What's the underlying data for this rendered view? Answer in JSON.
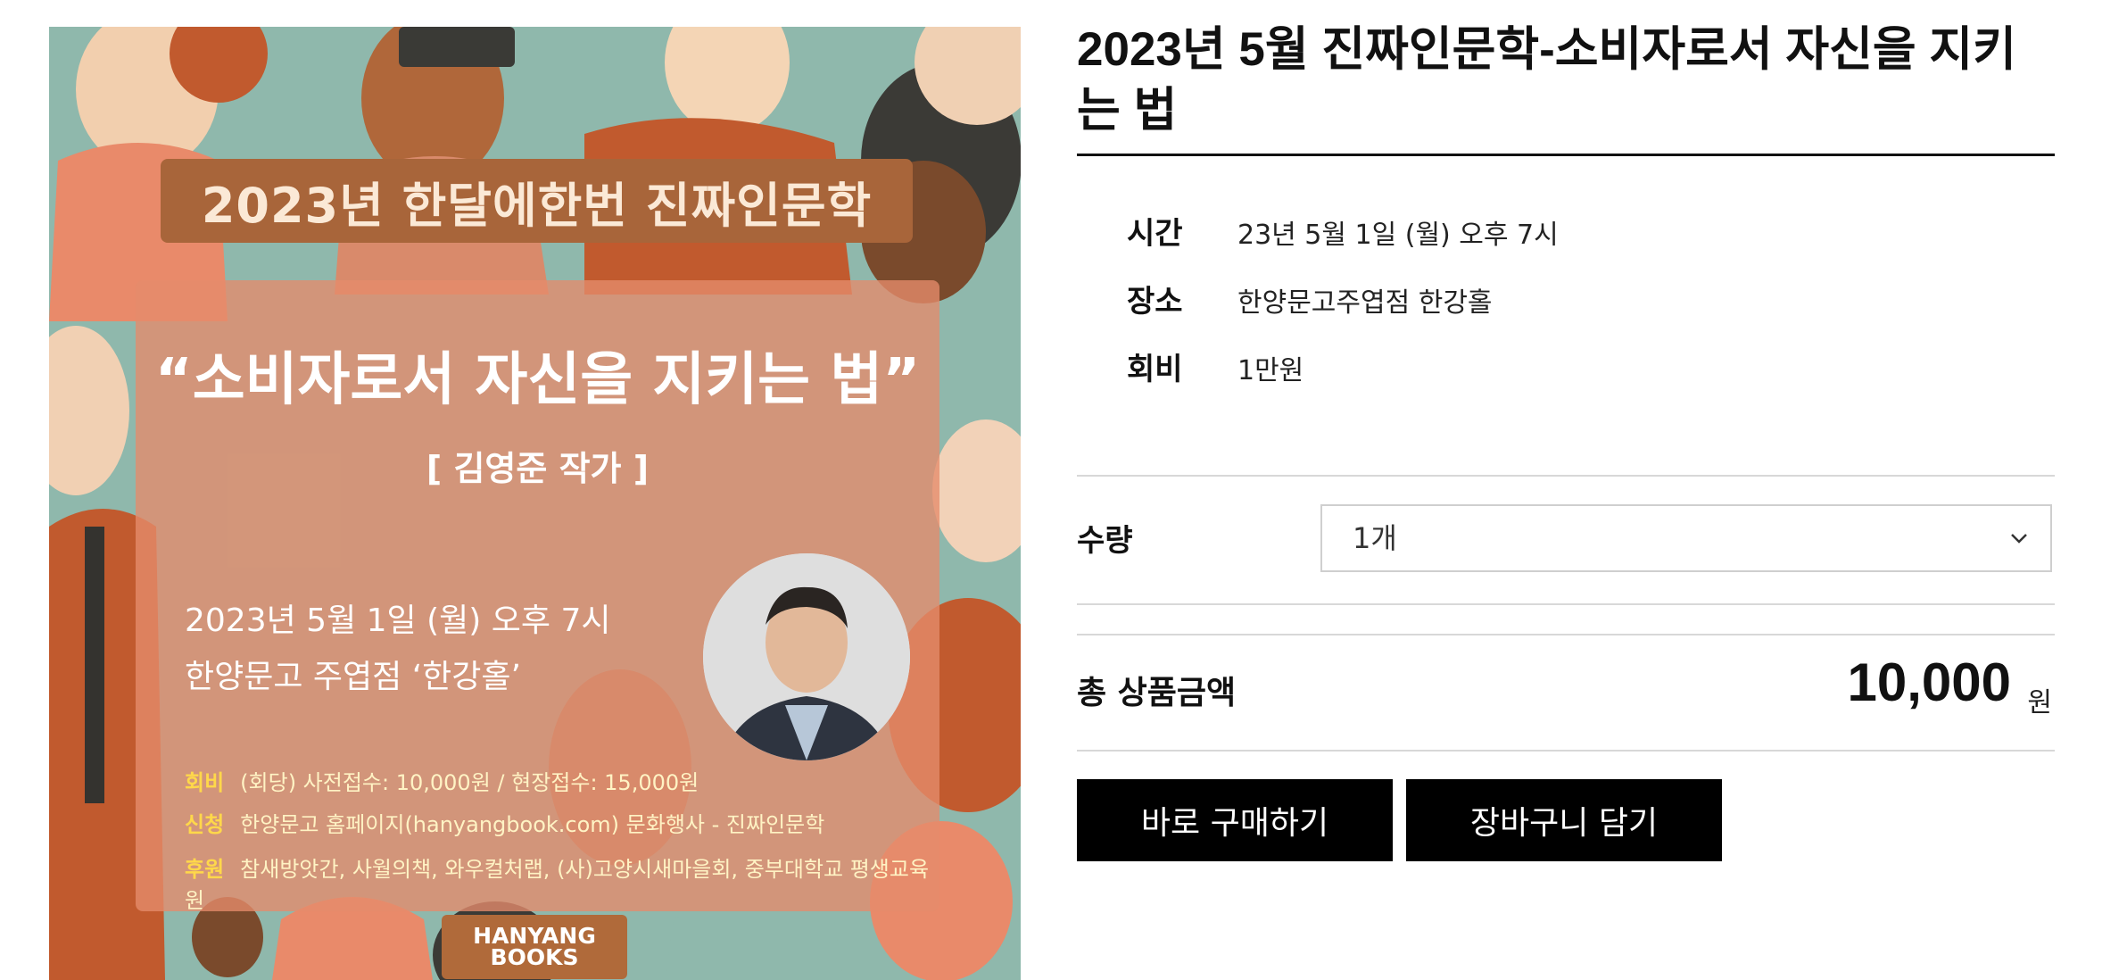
{
  "poster": {
    "series_title": "2023년 한달에한번 진짜인문학",
    "headline": "“소비자로서 자신을 지키는 법”",
    "author": "[ 김영준 작가 ]",
    "date": "2023년 5월 1일 (월) 오후 7시",
    "venue": "한양문고 주엽점 ‘한강홀’",
    "info": [
      {
        "key": "회비",
        "text": "(회당) 사전접수: 10,000원 / 현장접수: 15,000원"
      },
      {
        "key": "신청",
        "text": "한양문고 홈페이지(hanyangbook.com) 문화행사 - 진짜인문학"
      },
      {
        "key": "후원",
        "text": "참새방앗간, 사월의책, 와우컬처랩, (사)고양시새마을회, 중부대학교 평생교육원"
      }
    ],
    "logo_line1": "HANYANG",
    "logo_line2": "BOOKS"
  },
  "product": {
    "title": "2023년 5월 진짜인문학-소비자로서 자신을 지키는 법",
    "details": [
      {
        "label": "시간",
        "value": "23년 5월 1일 (월) 오후 7시"
      },
      {
        "label": "장소",
        "value": "한양문고주엽점 한강홀"
      },
      {
        "label": "회비",
        "value": "1만원"
      }
    ],
    "quantity_label": "수량",
    "quantity_selected": "1개",
    "total_label": "총 상품금액",
    "total_amount": "10,000",
    "total_unit": "원",
    "buy_now_label": "바로 구매하기",
    "add_cart_label": "장바구니 담기"
  },
  "colors": {
    "poster_bg": "#8fb8ac",
    "poster_band": "#a8653a",
    "poster_card": "#e68c6c",
    "button": "#000000"
  }
}
